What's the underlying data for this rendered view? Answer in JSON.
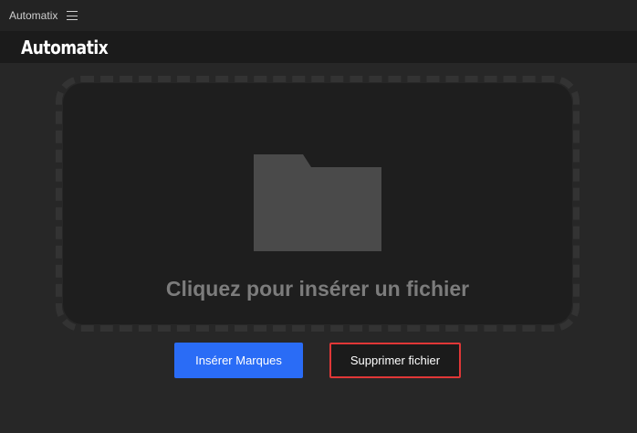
{
  "window": {
    "title": "Automatix",
    "menu_icon": "hamburger-menu-icon"
  },
  "header": {
    "brand": "Automatix"
  },
  "dropzone": {
    "icon": "folder-icon",
    "label": "Cliquez pour insérer un fichier"
  },
  "actions": {
    "insert_label": "Insérer Marques",
    "delete_label": "Supprimer fichier"
  },
  "colors": {
    "background": "#272727",
    "titlebar": "#232323",
    "appbar": "#1b1b1b",
    "dropzone_fill": "#1e1e1e",
    "dropzone_border": "#333333",
    "folder": "#4a4a4a",
    "label": "#7c7c7c",
    "primary": "#2a6cf6",
    "danger": "#e03737"
  }
}
